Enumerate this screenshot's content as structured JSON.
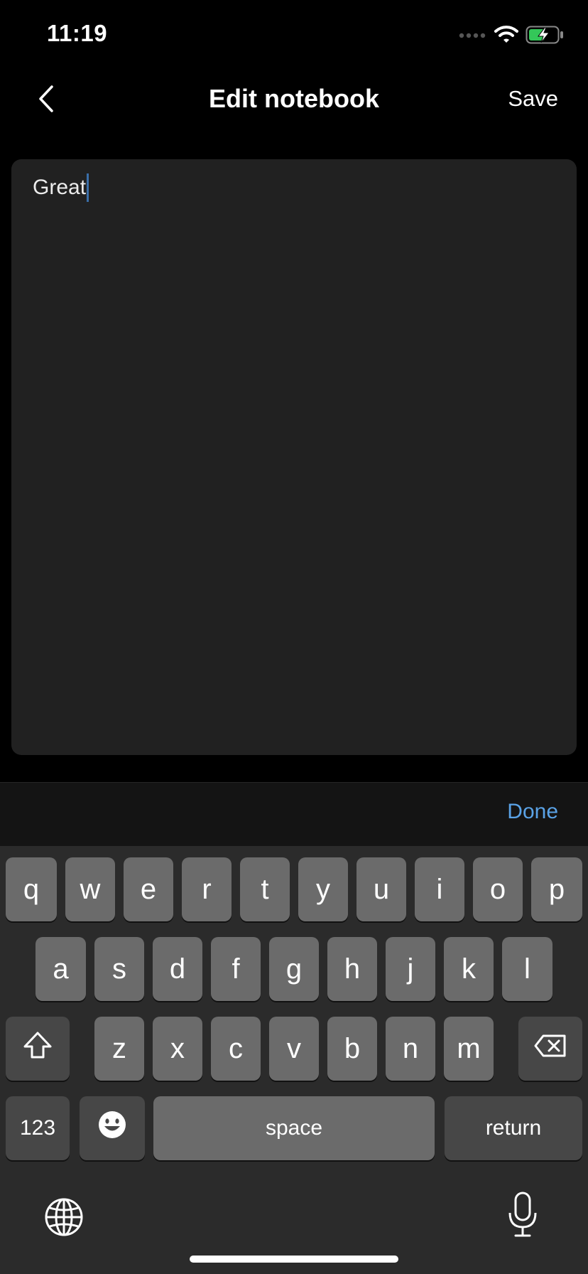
{
  "status_bar": {
    "time": "11:19"
  },
  "nav": {
    "title": "Edit notebook",
    "save_label": "Save"
  },
  "editor": {
    "value": "Great"
  },
  "accessory": {
    "done_label": "Done"
  },
  "keyboard": {
    "row1": [
      "q",
      "w",
      "e",
      "r",
      "t",
      "y",
      "u",
      "i",
      "o",
      "p"
    ],
    "row2": [
      "a",
      "s",
      "d",
      "f",
      "g",
      "h",
      "j",
      "k",
      "l"
    ],
    "row3": [
      "z",
      "x",
      "c",
      "v",
      "b",
      "n",
      "m"
    ],
    "numbers_label": "123",
    "space_label": "space",
    "return_label": "return"
  },
  "colors": {
    "accent": "#5aa2e6",
    "battery": "#34c759",
    "editor_bg": "#212121"
  }
}
